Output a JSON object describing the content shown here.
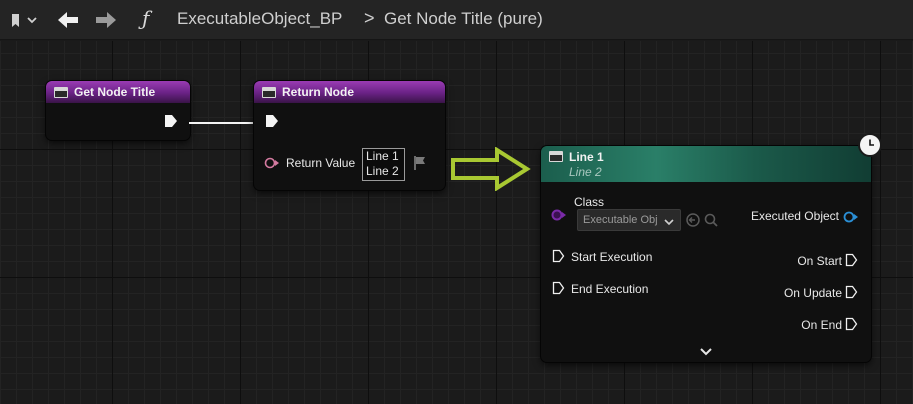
{
  "toolbar": {
    "bookmark_icon": "bookmark-dropdown-icon",
    "back_icon": "arrow-left-icon",
    "forward_icon": "arrow-right-icon",
    "function_symbol": "ƒ",
    "breadcrumb_blueprint": "ExecutableObject_BP",
    "breadcrumb_separator": ">",
    "breadcrumb_function": "Get Node Title (pure)"
  },
  "nodes": {
    "get_node_title": {
      "title": "Get Node Title"
    },
    "return_node": {
      "title": "Return Node",
      "return_value_label": "Return Value",
      "return_value_lines": [
        "Line 1",
        "Line 2"
      ]
    },
    "line_node": {
      "title": "Line 1",
      "subtitle": "Line 2",
      "class_label": "Class",
      "class_value": "Executable Obj",
      "executed_object_label": "Executed Object",
      "start_execution_label": "Start Execution",
      "end_execution_label": "End Execution",
      "on_start_label": "On Start",
      "on_update_label": "On Update",
      "on_end_label": "On End"
    }
  },
  "colors": {
    "purple_header": "#7b2a96",
    "teal_header": "#2a7f68",
    "object_pin": "#2a8fd6",
    "class_pin": "#7a2aa8",
    "text_pin": "#d47aa0",
    "arrow": "#a8c832"
  }
}
